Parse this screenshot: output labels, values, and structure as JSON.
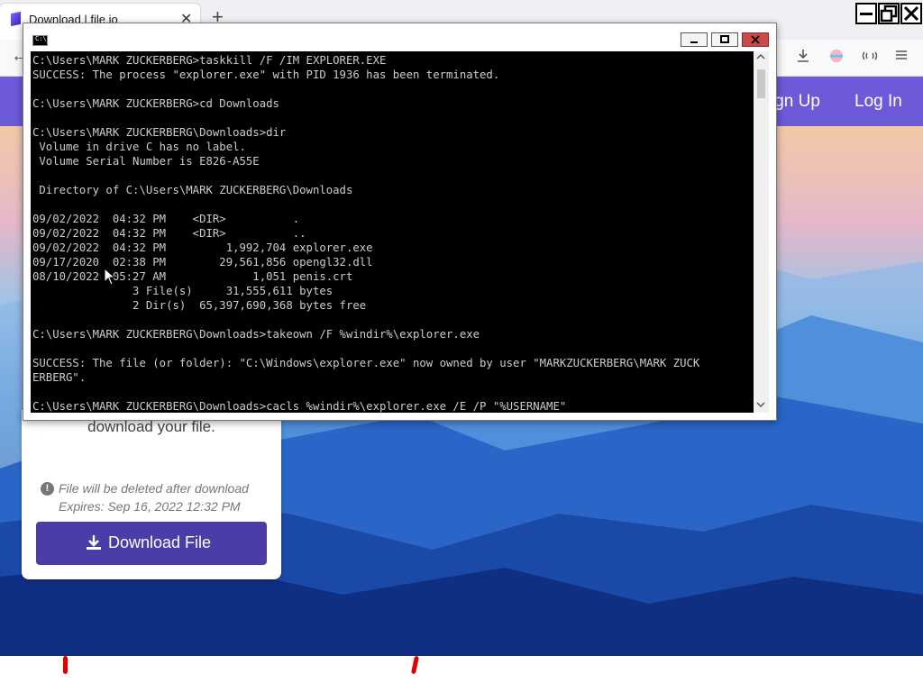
{
  "browser": {
    "tab_title": "Download | file.io",
    "tab_close": "✕",
    "new_tab": "+",
    "back": "←"
  },
  "site": {
    "nav_signup": "ign Up",
    "nav_login": "Log In"
  },
  "card": {
    "text": "download your file.",
    "warn_glyph": "!",
    "delete_note": "File will be deleted after download",
    "expires": "Expires: Sep 16, 2022 12:32 PM",
    "download_label": "Download File"
  },
  "cmd": {
    "icon_label": "C:\\_",
    "lines": [
      "C:\\Users\\MARK ZUCKERBERG>taskkill /F /IM EXPLORER.EXE",
      "SUCCESS: The process \"explorer.exe\" with PID 1936 has been terminated.",
      "",
      "C:\\Users\\MARK ZUCKERBERG>cd Downloads",
      "",
      "C:\\Users\\MARK ZUCKERBERG\\Downloads>dir",
      " Volume in drive C has no label.",
      " Volume Serial Number is E826-A55E",
      "",
      " Directory of C:\\Users\\MARK ZUCKERBERG\\Downloads",
      "",
      "09/02/2022  04:32 PM    <DIR>          .",
      "09/02/2022  04:32 PM    <DIR>          ..",
      "09/02/2022  04:32 PM         1,992,704 explorer.exe",
      "09/17/2020  02:38 PM        29,561,856 opengl32.dll",
      "08/10/2022  05:27 AM             1,051 penis.crt",
      "               3 File(s)     31,555,611 bytes",
      "               2 Dir(s)  65,397,690,368 bytes free",
      "",
      "C:\\Users\\MARK ZUCKERBERG\\Downloads>takeown /F %windir%\\explorer.exe",
      "",
      "SUCCESS: The file (or folder): \"C:\\Windows\\explorer.exe\" now owned by user \"MARKZUCKERBERG\\MARK ZUCK",
      "ERBERG\".",
      "",
      "C:\\Users\\MARK ZUCKERBERG\\Downloads>cacls %windir%\\explorer.exe /E /P \"%USERNAME\""
    ]
  },
  "colors": {
    "header": "#6c5ad8",
    "download_button": "#4a3da8",
    "console_bg": "#000000",
    "console_text": "#cccccc",
    "close_button": "#c94a4a"
  }
}
